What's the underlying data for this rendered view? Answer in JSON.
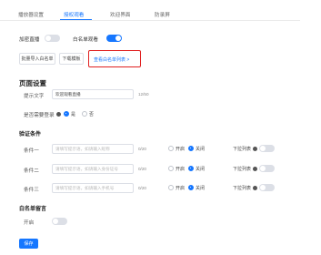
{
  "tabs": [
    {
      "label": "播放器设置"
    },
    {
      "label": "授权观看"
    },
    {
      "label": "欢迎界面"
    },
    {
      "label": "防录屏"
    }
  ],
  "top_toggles": {
    "encrypt_label": "加密直播",
    "whitelist_label": "白名单观看"
  },
  "actions": {
    "batch_import": "批量导入白名单",
    "download_template": "下载模板",
    "view_whitelist": "查看白名单列表 >"
  },
  "page_settings": {
    "title": "页面设置",
    "prompt_label": "提示文字",
    "prompt_value": "欢迎观看直播",
    "prompt_count": "12/50",
    "show_login_label": "是否需要登录",
    "yes": "是",
    "no": "否"
  },
  "verify": {
    "title": "验证条件",
    "conditions": [
      {
        "label": "条件一",
        "placeholder": "请填写提示语，如请输入昵称",
        "count": "0/20",
        "on": "开启",
        "off": "关闭",
        "dropdown": "下拉列表"
      },
      {
        "label": "条件二",
        "placeholder": "请填写提示语，如请输入身份证号",
        "count": "0/20",
        "on": "开启",
        "off": "关闭",
        "dropdown": "下拉列表"
      },
      {
        "label": "条件三",
        "placeholder": "请填写提示语，如请输入手机号",
        "count": "0/20",
        "on": "开启",
        "off": "关闭",
        "dropdown": "下拉列表"
      }
    ]
  },
  "whitelist_message": {
    "title": "白名单留言",
    "enable_label": "开启"
  },
  "save_label": "保存",
  "colors": {
    "accent": "#1677ff",
    "highlight": "#e02020"
  }
}
